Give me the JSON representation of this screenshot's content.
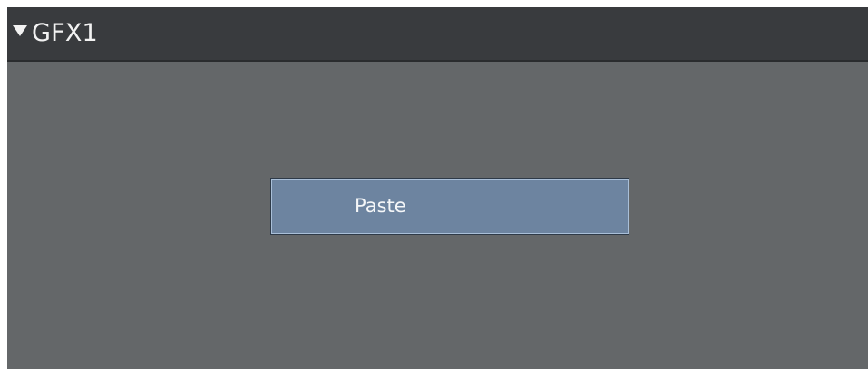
{
  "panel": {
    "title": "GFX1",
    "collapse_icon": "triangle-down-icon",
    "expanded": true
  },
  "content": {
    "paste_label": "Paste"
  },
  "colors": {
    "header_bg": "#393b3e",
    "panel_bg": "#646769",
    "button_bg": "#6d84a0",
    "button_border": "#a9bfd8",
    "text": "#f2f2f2"
  }
}
